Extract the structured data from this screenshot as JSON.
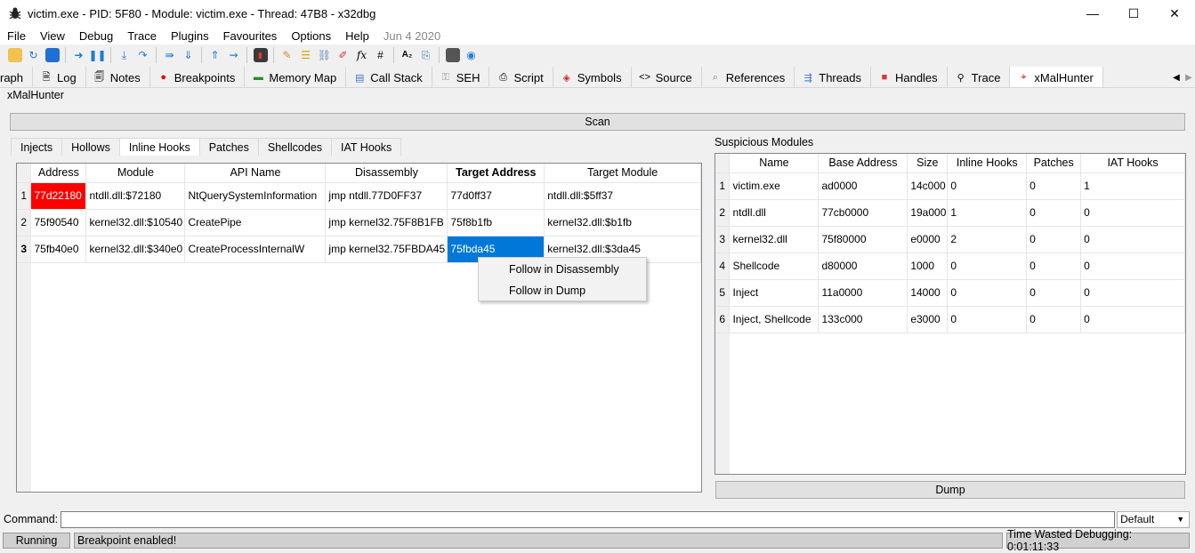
{
  "window": {
    "title": "victim.exe - PID: 5F80 - Module: victim.exe - Thread: 47B8 - x32dbg",
    "minimize": "—",
    "maximize": "☐",
    "close": "✕"
  },
  "menu": {
    "items": [
      "File",
      "View",
      "Debug",
      "Trace",
      "Plugins",
      "Favourites",
      "Options",
      "Help"
    ],
    "date": "Jun 4 2020"
  },
  "tabs": [
    {
      "label": "raph",
      "icon": "graph-icon"
    },
    {
      "label": "Log",
      "icon": "log-icon"
    },
    {
      "label": "Notes",
      "icon": "notes-icon"
    },
    {
      "label": "Breakpoints",
      "icon": "breakpoint-icon"
    },
    {
      "label": "Memory Map",
      "icon": "memory-icon"
    },
    {
      "label": "Call Stack",
      "icon": "callstack-icon"
    },
    {
      "label": "SEH",
      "icon": "seh-icon"
    },
    {
      "label": "Script",
      "icon": "script-icon"
    },
    {
      "label": "Symbols",
      "icon": "symbols-icon"
    },
    {
      "label": "Source",
      "icon": "source-icon"
    },
    {
      "label": "References",
      "icon": "references-icon"
    },
    {
      "label": "Threads",
      "icon": "threads-icon"
    },
    {
      "label": "Handles",
      "icon": "handles-icon"
    },
    {
      "label": "Trace",
      "icon": "trace-icon"
    },
    {
      "label": "xMalHunter",
      "icon": "crosshair-icon"
    }
  ],
  "plugin_title": "xMalHunter",
  "scan_label": "Scan",
  "subtabs": [
    "Injects",
    "Hollows",
    "Inline Hooks",
    "Patches",
    "Shellcodes",
    "IAT Hooks"
  ],
  "hooks_table": {
    "headers": [
      "Address",
      "Module",
      "API Name",
      "Disassembly",
      "Target Address",
      "Target Module"
    ],
    "rows": [
      {
        "num": "1",
        "cells": [
          "77d22180",
          "ntdll.dll:$72180",
          "NtQuerySystemInformation",
          "jmp ntdll.77D0FF37",
          "77d0ff37",
          "ntdll.dll:$5ff37"
        ]
      },
      {
        "num": "2",
        "cells": [
          "75f90540",
          "kernel32.dll:$10540",
          "CreatePipe",
          "jmp kernel32.75F8B1FB",
          "75f8b1fb",
          "kernel32.dll:$b1fb"
        ]
      },
      {
        "num": "3",
        "cells": [
          "75fb40e0",
          "kernel32.dll:$340e0",
          "CreateProcessInternalW",
          "jmp kernel32.75FBDA45",
          "75fbda45",
          "kernel32.dll:$3da45"
        ]
      }
    ]
  },
  "context_menu": [
    "Follow in Disassembly",
    "Follow in Dump"
  ],
  "modules_label": "Suspicious Modules",
  "modules_table": {
    "headers": [
      "Name",
      "Base Address",
      "Size",
      "Inline Hooks",
      "Patches",
      "IAT Hooks"
    ],
    "rows": [
      {
        "num": "1",
        "cells": [
          "victim.exe",
          "ad0000",
          "14c000",
          "0",
          "0",
          "1"
        ]
      },
      {
        "num": "2",
        "cells": [
          "ntdll.dll",
          "77cb0000",
          "19a000",
          "1",
          "0",
          "0"
        ]
      },
      {
        "num": "3",
        "cells": [
          "kernel32.dll",
          "75f80000",
          "e0000",
          "2",
          "0",
          "0"
        ]
      },
      {
        "num": "4",
        "cells": [
          "Shellcode",
          "d80000",
          "1000",
          "0",
          "0",
          "0"
        ]
      },
      {
        "num": "5",
        "cells": [
          "Inject",
          "11a0000",
          "14000",
          "0",
          "0",
          "0"
        ]
      },
      {
        "num": "6",
        "cells": [
          "Inject, Shellcode",
          "133c000",
          "e3000",
          "0",
          "0",
          "0"
        ]
      }
    ]
  },
  "dump_label": "Dump",
  "command": {
    "label": "Command:",
    "value": "",
    "select": "Default"
  },
  "status": {
    "state": "Running",
    "message": "Breakpoint enabled!",
    "time": "Time Wasted Debugging: 0:01:11:33"
  },
  "colors": {
    "highlight_red": "#ff0000",
    "selection_blue": "#0078d7"
  }
}
